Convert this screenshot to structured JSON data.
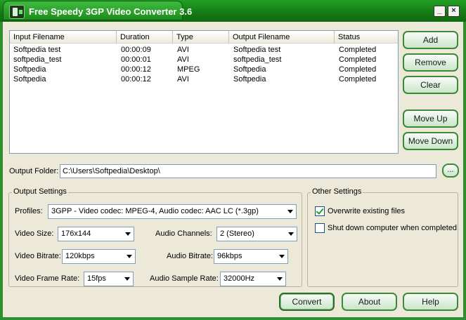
{
  "window": {
    "title": "Free Speedy 3GP Video Converter 3.6",
    "minimize_glyph": "_",
    "close_glyph": "×"
  },
  "list": {
    "columns": [
      "Input Filename",
      "Duration",
      "Type",
      "Output Filename",
      "Status"
    ],
    "rows": [
      [
        "Softpedia test",
        "00:00:09",
        "AVI",
        "Softpedia test",
        "Completed"
      ],
      [
        "softpedia_test",
        "00:00:01",
        "AVI",
        "softpedia_test",
        "Completed"
      ],
      [
        "Softpedia",
        "00:00:12",
        "MPEG",
        "Softpedia",
        "Completed"
      ],
      [
        "Softpedia",
        "00:00:12",
        "AVI",
        "Softpedia",
        "Completed"
      ]
    ]
  },
  "side_buttons": {
    "add": "Add",
    "remove": "Remove",
    "clear": "Clear",
    "move_up": "Move Up",
    "move_down": "Move Down"
  },
  "output_folder": {
    "label": "Output Folder:",
    "value": "C:\\Users\\Softpedia\\Desktop\\",
    "browse": "..."
  },
  "output_settings": {
    "title": "Output Settings",
    "profiles_label": "Profiles:",
    "profiles_value": "3GPP - Video codec: MPEG-4, Audio codec: AAC LC (*.3gp)",
    "video_size_label": "Video Size:",
    "video_size_value": "176x144",
    "audio_channels_label": "Audio Channels:",
    "audio_channels_value": "2 (Stereo)",
    "video_bitrate_label": "Video Bitrate:",
    "video_bitrate_value": "120kbps",
    "audio_bitrate_label": "Audio Bitrate:",
    "audio_bitrate_value": "96kbps",
    "video_frame_rate_label": "Video Frame Rate:",
    "video_frame_rate_value": "15fps",
    "audio_sample_rate_label": "Audio Sample Rate:",
    "audio_sample_rate_value": "32000Hz"
  },
  "other_settings": {
    "title": "Other Settings",
    "overwrite_label": "Overwrite existing files",
    "overwrite_checked": true,
    "shutdown_label": "Shut down computer when completed",
    "shutdown_checked": false
  },
  "bottom_buttons": {
    "convert": "Convert",
    "about": "About",
    "help": "Help"
  }
}
